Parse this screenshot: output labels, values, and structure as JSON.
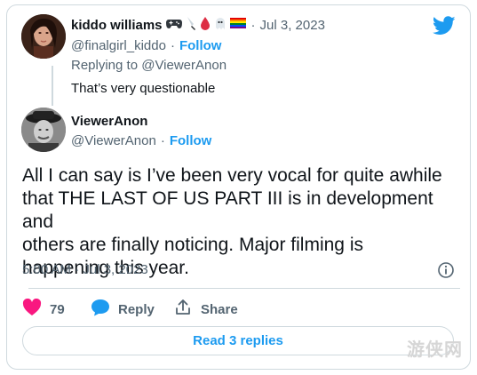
{
  "brand_color": "#1d9bf0",
  "reply_tweet": {
    "display_name": "kiddo williams",
    "name_emojis": [
      "game-controller-icon",
      "knife-icon",
      "blood-drop-icon",
      "ghost-icon",
      "rainbow-flag-icon"
    ],
    "separator": "·",
    "date": "Jul 3, 2023",
    "handle": "@finalgirl_kiddo",
    "follow_label": "Follow",
    "replying_to": "Replying to @ViewerAnon",
    "text": "That’s very questionable"
  },
  "main_tweet": {
    "display_name": "ViewerAnon",
    "handle": "@ViewerAnon",
    "separator": "·",
    "follow_label": "Follow",
    "text_lines": [
      "All I can say is I’ve been very vocal for quite awhile",
      "that THE LAST OF US PART III is in development and",
      "others are finally noticing. Major filming is",
      "happening this year."
    ],
    "timestamp": "5:00 AM · Jul 3, 2023"
  },
  "actions": {
    "like_count": "79",
    "reply_label": "Reply",
    "share_label": "Share"
  },
  "read_replies_label": "Read 3 replies",
  "watermark": "游侠网"
}
